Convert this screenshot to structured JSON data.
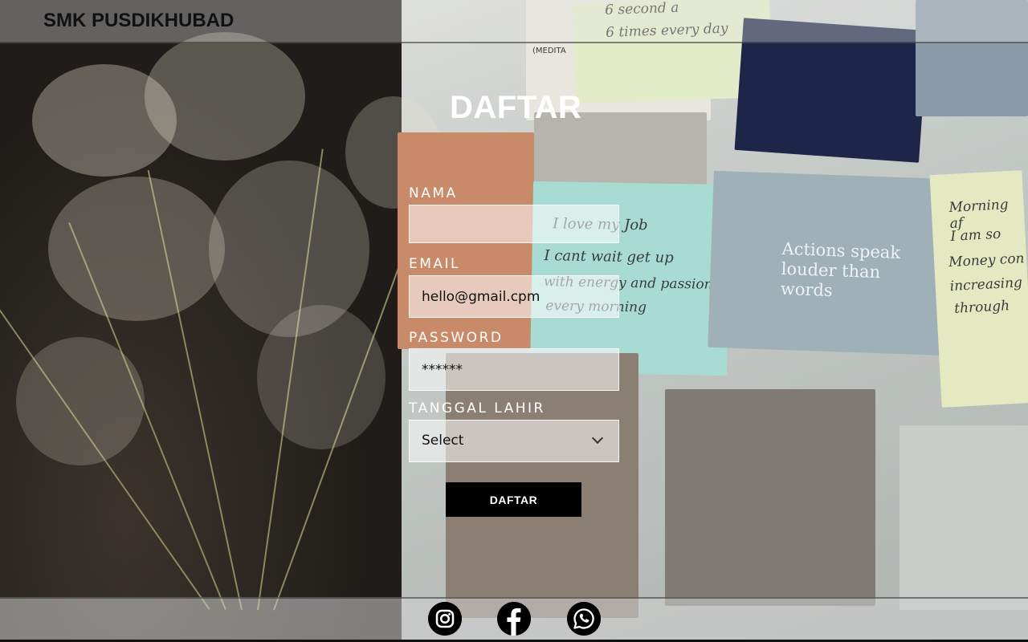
{
  "header": {
    "brand": "SMK PUSDIKHUBAD"
  },
  "form": {
    "title": "DAFTAR",
    "fields": [
      {
        "label": "NAMA",
        "value": ""
      },
      {
        "label": "EMAIL",
        "value": "hello@gmail.cpm"
      },
      {
        "label": "PASSWORD",
        "value": "******"
      },
      {
        "label": "TANGGAL LAHIR",
        "value": "Select"
      }
    ],
    "submit_label": "DAFTAR"
  },
  "footer": {
    "social": [
      {
        "name": "instagram-icon"
      },
      {
        "name": "facebook-icon"
      },
      {
        "name": "whatsapp-icon"
      }
    ]
  },
  "background": {
    "notes": [
      "6 second a",
      "6 times every day",
      "I love my Job",
      "I cant wait get up",
      "with energy and passion",
      "every morning",
      "Morning af",
      "I am so",
      "Money con",
      "increasing",
      "through"
    ],
    "poster_text": "Actions speak louder than words",
    "meditation_text": "(MEDITA"
  }
}
